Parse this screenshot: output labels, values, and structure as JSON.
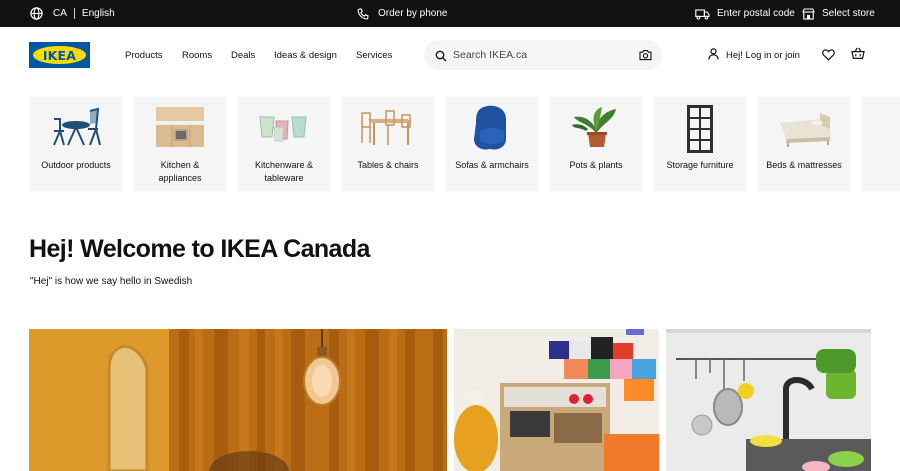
{
  "topbar": {
    "country": "CA",
    "language": "English",
    "order_by_phone": "Order by phone",
    "postal_code": "Enter postal code",
    "select_store": "Select store"
  },
  "header": {
    "logo_text": "IKEA",
    "nav": [
      "Products",
      "Rooms",
      "Deals",
      "Ideas & design",
      "Services"
    ],
    "search_placeholder": "Search IKEA.ca",
    "login": "Hej! Log in or join"
  },
  "categories": [
    {
      "label": "Outdoor products",
      "icon": "outdoor-table-chairs-icon"
    },
    {
      "label": "Kitchen & appliances",
      "icon": "kitchen-cabinet-icon"
    },
    {
      "label": "Kitchenware & tableware",
      "icon": "glasses-icon"
    },
    {
      "label": "Tables & chairs",
      "icon": "dining-table-icon"
    },
    {
      "label": "Sofas & armchairs",
      "icon": "armchair-icon"
    },
    {
      "label": "Pots & plants",
      "icon": "potted-plant-icon"
    },
    {
      "label": "Storage furniture",
      "icon": "shelf-unit-icon"
    },
    {
      "label": "Beds & mattresses",
      "icon": "bed-icon"
    }
  ],
  "welcome": {
    "title": "Hej! Welcome to IKEA Canada",
    "subtitle": "\"Hej\" is how we say hello in Swedish"
  },
  "colors": {
    "topbar": "#111111",
    "ikea_blue": "#0058a3",
    "ikea_yellow": "#ffdb00",
    "tile_bg": "#f5f5f5"
  }
}
